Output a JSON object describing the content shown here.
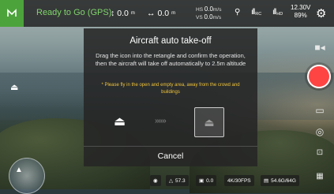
{
  "status_bar": {
    "flight_status": "Ready to Go (GPS)",
    "height_value": "0.0",
    "height_unit": "m",
    "distance_value": "0.0",
    "distance_unit": "m",
    "hs_label": "HS",
    "hs_value": "0.0",
    "hs_unit": "m/s",
    "vs_label": "VS",
    "vs_value": "0.0",
    "vs_unit": "m/s",
    "rc_label": "RC",
    "hd_label": "HD",
    "battery_voltage": "12.30V",
    "battery_percent": "89%"
  },
  "modal": {
    "title": "Aircraft auto take-off",
    "description": "Drag the icon into the retangle and confirm the operation, then the aircraft will take off automatically to 2.5m altitude",
    "warning": "* Please fly in the open and empty area, away from the crowd and buildings",
    "arrows": "»»»",
    "cancel_label": "Cancel"
  },
  "bottom_bar": {
    "ev": "57.3",
    "iso": "0.0",
    "video_mode": "4K/30FPS",
    "storage": "54.6G/64G"
  },
  "colors": {
    "accent_green": "#4ca33b",
    "status_green": "#7fd66b",
    "warning_yellow": "#f0c43a",
    "record_red": "#f44444"
  }
}
